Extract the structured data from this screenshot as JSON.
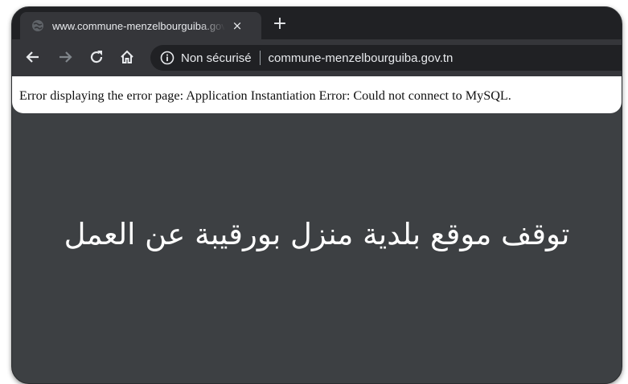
{
  "browser": {
    "tab": {
      "title": "www.commune-menzelbourguiba.gov.tn",
      "close_label": "×",
      "favicon": "globe-icon"
    },
    "new_tab_label": "+",
    "nav": {
      "back_icon": "arrow-left-icon",
      "forward_icon": "arrow-right-icon",
      "reload_icon": "reload-icon",
      "home_icon": "home-icon"
    },
    "omnibox": {
      "security_label": "Non sécurisé",
      "url": "commune-menzelbourguiba.gov.tn",
      "info_icon": "info-icon"
    }
  },
  "page": {
    "error_message": "Error displaying the error page: Application Instantiation Error: Could not connect to MySQL."
  },
  "overlay": {
    "caption": "توقف موقع بلدية منزل بورقيبة عن العمل"
  },
  "colors": {
    "tab_strip": "#202124",
    "toolbar": "#35363a",
    "omnibox": "#202124",
    "page_background": "#3d4043",
    "text_light": "#e8eaed"
  }
}
